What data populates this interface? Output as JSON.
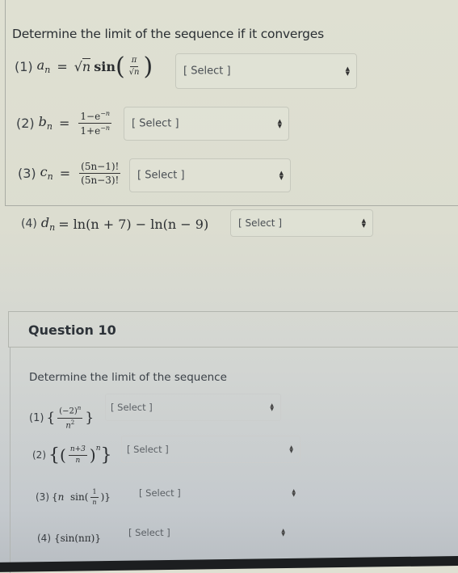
{
  "question9": {
    "prompt": "Determine the limit of the sequence if it converges",
    "items": [
      {
        "label": "(1)",
        "expr": "a_n = √n sin(π/√n)",
        "lhs": "a",
        "sub": "n",
        "selected": "[ Select ]"
      },
      {
        "label": "(2)",
        "expr": "b_n = (1−e^−n)/(1+e^−n)",
        "lhs": "b",
        "sub": "n",
        "num": "1−e",
        "num_exp": "−n",
        "den": "1+e",
        "den_exp": "−n",
        "selected": "[ Select ]"
      },
      {
        "label": "(3)",
        "expr": "c_n = (5n−1)!/(5n−3)!",
        "lhs": "c",
        "sub": "n",
        "num": "(5n−1)!",
        "den": "(5n−3)!",
        "selected": "[ Select ]"
      },
      {
        "label": "(4)",
        "expr": "d_n = ln(n+7) − ln(n−9)",
        "lhs": "d",
        "sub": "n",
        "rhs": "= ln(n + 7) − ln(n − 9)",
        "selected": "[ Select ]"
      }
    ]
  },
  "question10": {
    "title": "Question 10",
    "prompt": "Determine the limit of the sequence",
    "items": [
      {
        "label": "(1)",
        "expr": "{(−2)^n / n^2}",
        "num": "(−2)",
        "num_exp": "n",
        "den": "n",
        "den_exp": "2",
        "selected": "[ Select ]"
      },
      {
        "label": "(2)",
        "expr": "{((n+3)/n)^n}",
        "num": "n+3",
        "den": "n",
        "exp": "n",
        "selected": "[ Select ]"
      },
      {
        "label": "(3)",
        "expr": "{n sin(1/n)}",
        "num": "1",
        "den": "n",
        "selected": "[ Select ]"
      },
      {
        "label": "(4)",
        "expr": "{sin(nπ)}",
        "rhs": "{sin(nπ)}",
        "selected": "[ Select ]"
      }
    ]
  },
  "icons": {
    "select_arrows": "▲▼"
  }
}
